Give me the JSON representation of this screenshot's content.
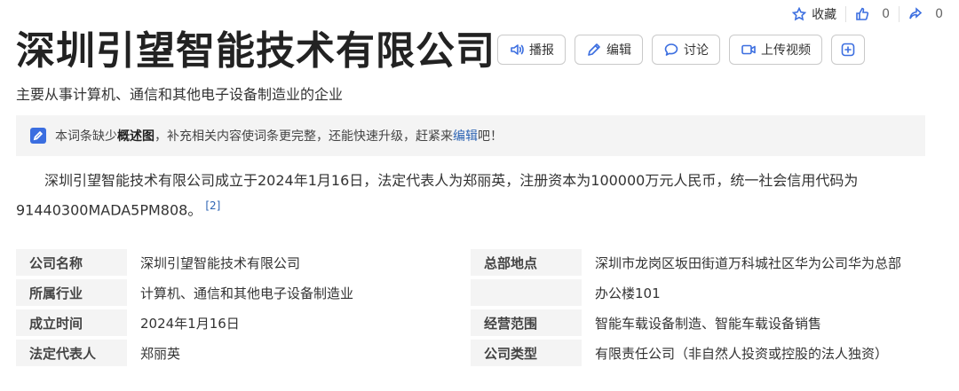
{
  "topbar": {
    "favorite_label": "收藏",
    "like_count": "0",
    "share_count": "0"
  },
  "page": {
    "title": "深圳引望智能技术有限公司",
    "subtitle": "主要从事计算机、通信和其他电子设备制造业的企业"
  },
  "actions": {
    "broadcast": "播报",
    "edit": "编辑",
    "discuss": "讨论",
    "upload_video": "上传视频"
  },
  "notice": {
    "text_before": "本词条缺少",
    "bold_text": "概述图",
    "text_middle": "，补充相关内容使词条更完整，还能快速升级，赶紧来",
    "link_text": "编辑",
    "text_after": "吧！"
  },
  "summary": {
    "text": "深圳引望智能技术有限公司成立于2024年1月16日，法定代表人为郑丽英，注册资本为100000万元人民币，统一社会信用代码为91440300MADA5PM808。",
    "ref": "[2]"
  },
  "info": {
    "rows": [
      {
        "l1": "公司名称",
        "v1": "深圳引望智能技术有限公司",
        "l2": "总部地点",
        "v2": "深圳市龙岗区坂田街道万科城社区华为公司华为总部"
      },
      {
        "l1": "所属行业",
        "v1": "计算机、通信和其他电子设备制造业",
        "l2": "",
        "v2": "办公楼101"
      },
      {
        "l1": "成立时间",
        "v1": "2024年1月16日",
        "l2": "经营范围",
        "v2": "智能车载设备制造、智能车载设备销售"
      },
      {
        "l1": "法定代表人",
        "v1": "郑丽英",
        "l2": "公司类型",
        "v2": "有限责任公司（非自然人投资或控股的法人独资）"
      }
    ]
  },
  "colors": {
    "accent": "#3b6ee0",
    "link": "#2d64b3",
    "label_bg": "#f4f4f4"
  }
}
